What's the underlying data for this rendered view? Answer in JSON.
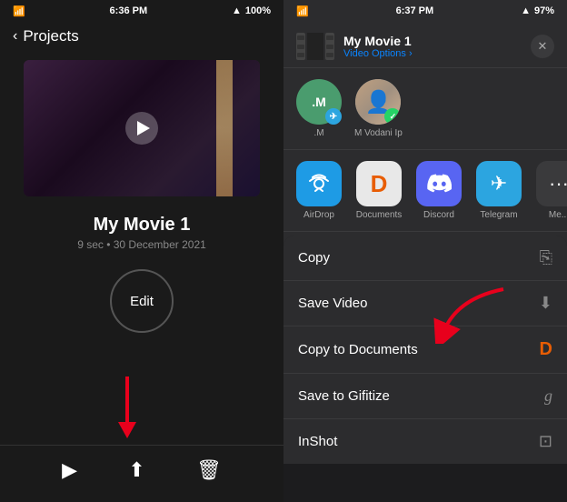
{
  "left": {
    "status": {
      "time": "6:36 PM",
      "battery": "100%"
    },
    "nav": {
      "back_label": "Projects"
    },
    "movie": {
      "title": "My Movie 1",
      "meta": "9 sec • 30 December 2021"
    },
    "edit_label": "Edit",
    "toolbar": {
      "play_icon": "▶",
      "share_icon": "⬆",
      "delete_icon": "🗑"
    }
  },
  "right": {
    "status": {
      "time": "6:37 PM",
      "battery": "97%"
    },
    "share_sheet": {
      "title": "My Movie 1",
      "subtitle": "Video",
      "options_label": "Options ›",
      "close_label": "✕"
    },
    "contacts": [
      {
        "name": ".M",
        "initial": ".M"
      },
      {
        "name": "M Vodani Ip",
        "initial": ""
      }
    ],
    "apps": [
      {
        "name": "AirDrop",
        "icon": "📡"
      },
      {
        "name": "Documents",
        "icon": "D"
      },
      {
        "name": "Discord",
        "icon": "🎮"
      },
      {
        "name": "Telegram",
        "icon": "✈"
      },
      {
        "name": "Me...",
        "icon": "···"
      }
    ],
    "actions": [
      {
        "label": "Copy",
        "icon": "⎘"
      },
      {
        "label": "Save Video",
        "icon": "⬇"
      },
      {
        "label": "Copy to Documents",
        "icon": "D"
      },
      {
        "label": "Save to Gifitize",
        "icon": "g"
      },
      {
        "label": "InShot",
        "icon": "⊡"
      }
    ]
  }
}
